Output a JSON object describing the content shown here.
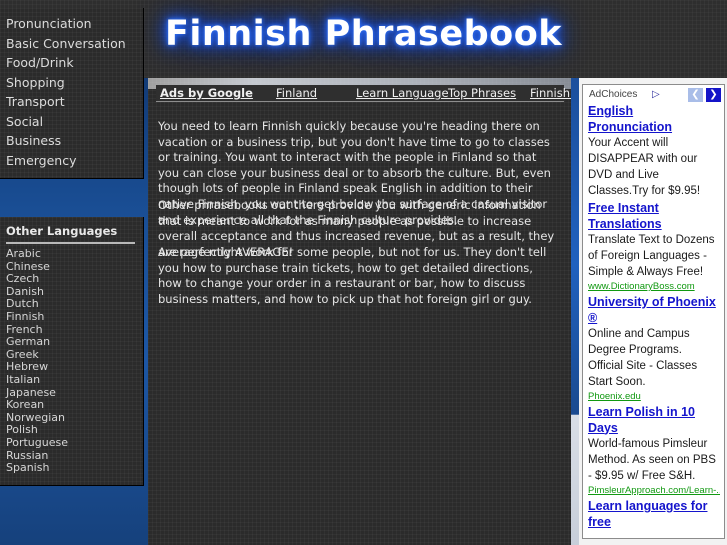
{
  "header": {
    "site_title": "Finnish Phrasebook"
  },
  "sidebar": {
    "nav_items": [
      "Pronunciation",
      "Basic Conversation",
      "Food/Drink",
      "Shopping",
      "Transport",
      "Social",
      "Business",
      "Emergency"
    ],
    "other_languages_title": "Other Languages",
    "languages": [
      "Arabic",
      "Chinese",
      "Czech",
      "Danish",
      "Dutch",
      "Finnish",
      "French",
      "German",
      "Greek",
      "Hebrew",
      "Italian",
      "Japanese",
      "Korean",
      "Norwegian",
      "Polish",
      "Portuguese",
      "Russian",
      "Spanish"
    ]
  },
  "ads_bar": {
    "label": "Ads by Google",
    "links": [
      "Finland",
      "Learn Language",
      "Top Phrases",
      "Finnish Online"
    ]
  },
  "main": {
    "paragraphs": [
      "You need to learn Finnish quickly because you're heading there on vacation or a business trip, but you don't have time to go to classes or training. You want to interact with the people in Finland so that you can close your business deal or to absorb the culture. But, even though lots of people in Finland speak English in addition to their native Finnish, you want to get below the surface of a casual visitor and experience all that the Finnish culture provides.",
      "Other phrasebooks out there provide you with generic information that is meant to work for as many people as possible to increase overall acceptance and thus increased revenue, but as a result, they are perfectly AVERAGE!",
      "Average might work for some people, but not for us. They don't tell you how to purchase train tickets, how to get detailed directions, how to change your order in a restaurant or bar, how to discuss business matters, and how to pick up that hot foreign girl or guy."
    ]
  },
  "ad_panel": {
    "adchoices_label": "AdChoices",
    "adchoices_icon": "▷",
    "prev_arrow": "❮",
    "next_arrow": "❯",
    "ads": [
      {
        "title": "English Pronunciation",
        "description": "Your Accent will DISAPPEAR with our DVD and Live Classes.Try for $9.95!",
        "url": ""
      },
      {
        "title": "Free Instant Translations",
        "description": "Translate Text to Dozens of Foreign Languages - Simple & Always Free!",
        "url": "www.DictionaryBoss.com"
      },
      {
        "title": "University of Phoenix ®",
        "description": "Online and Campus Degree Programs. Official Site - Classes Start Soon.",
        "url": "Phoenix.edu"
      },
      {
        "title": "Learn Polish in 10 Days",
        "description": "World-famous Pimsleur Method. As seen on PBS - $9.95 w/ Free S&H.",
        "url": "PimsleurApproach.com/Learn-..."
      },
      {
        "title": "Learn languages for free",
        "description": "",
        "url": ""
      }
    ]
  },
  "colors": {
    "accent_blue": "#1d57a5",
    "title_glow": "#2f6ff5",
    "ad_link": "#1414cc",
    "ad_url_green": "#119911",
    "page_dark": "#2b2b2b"
  }
}
